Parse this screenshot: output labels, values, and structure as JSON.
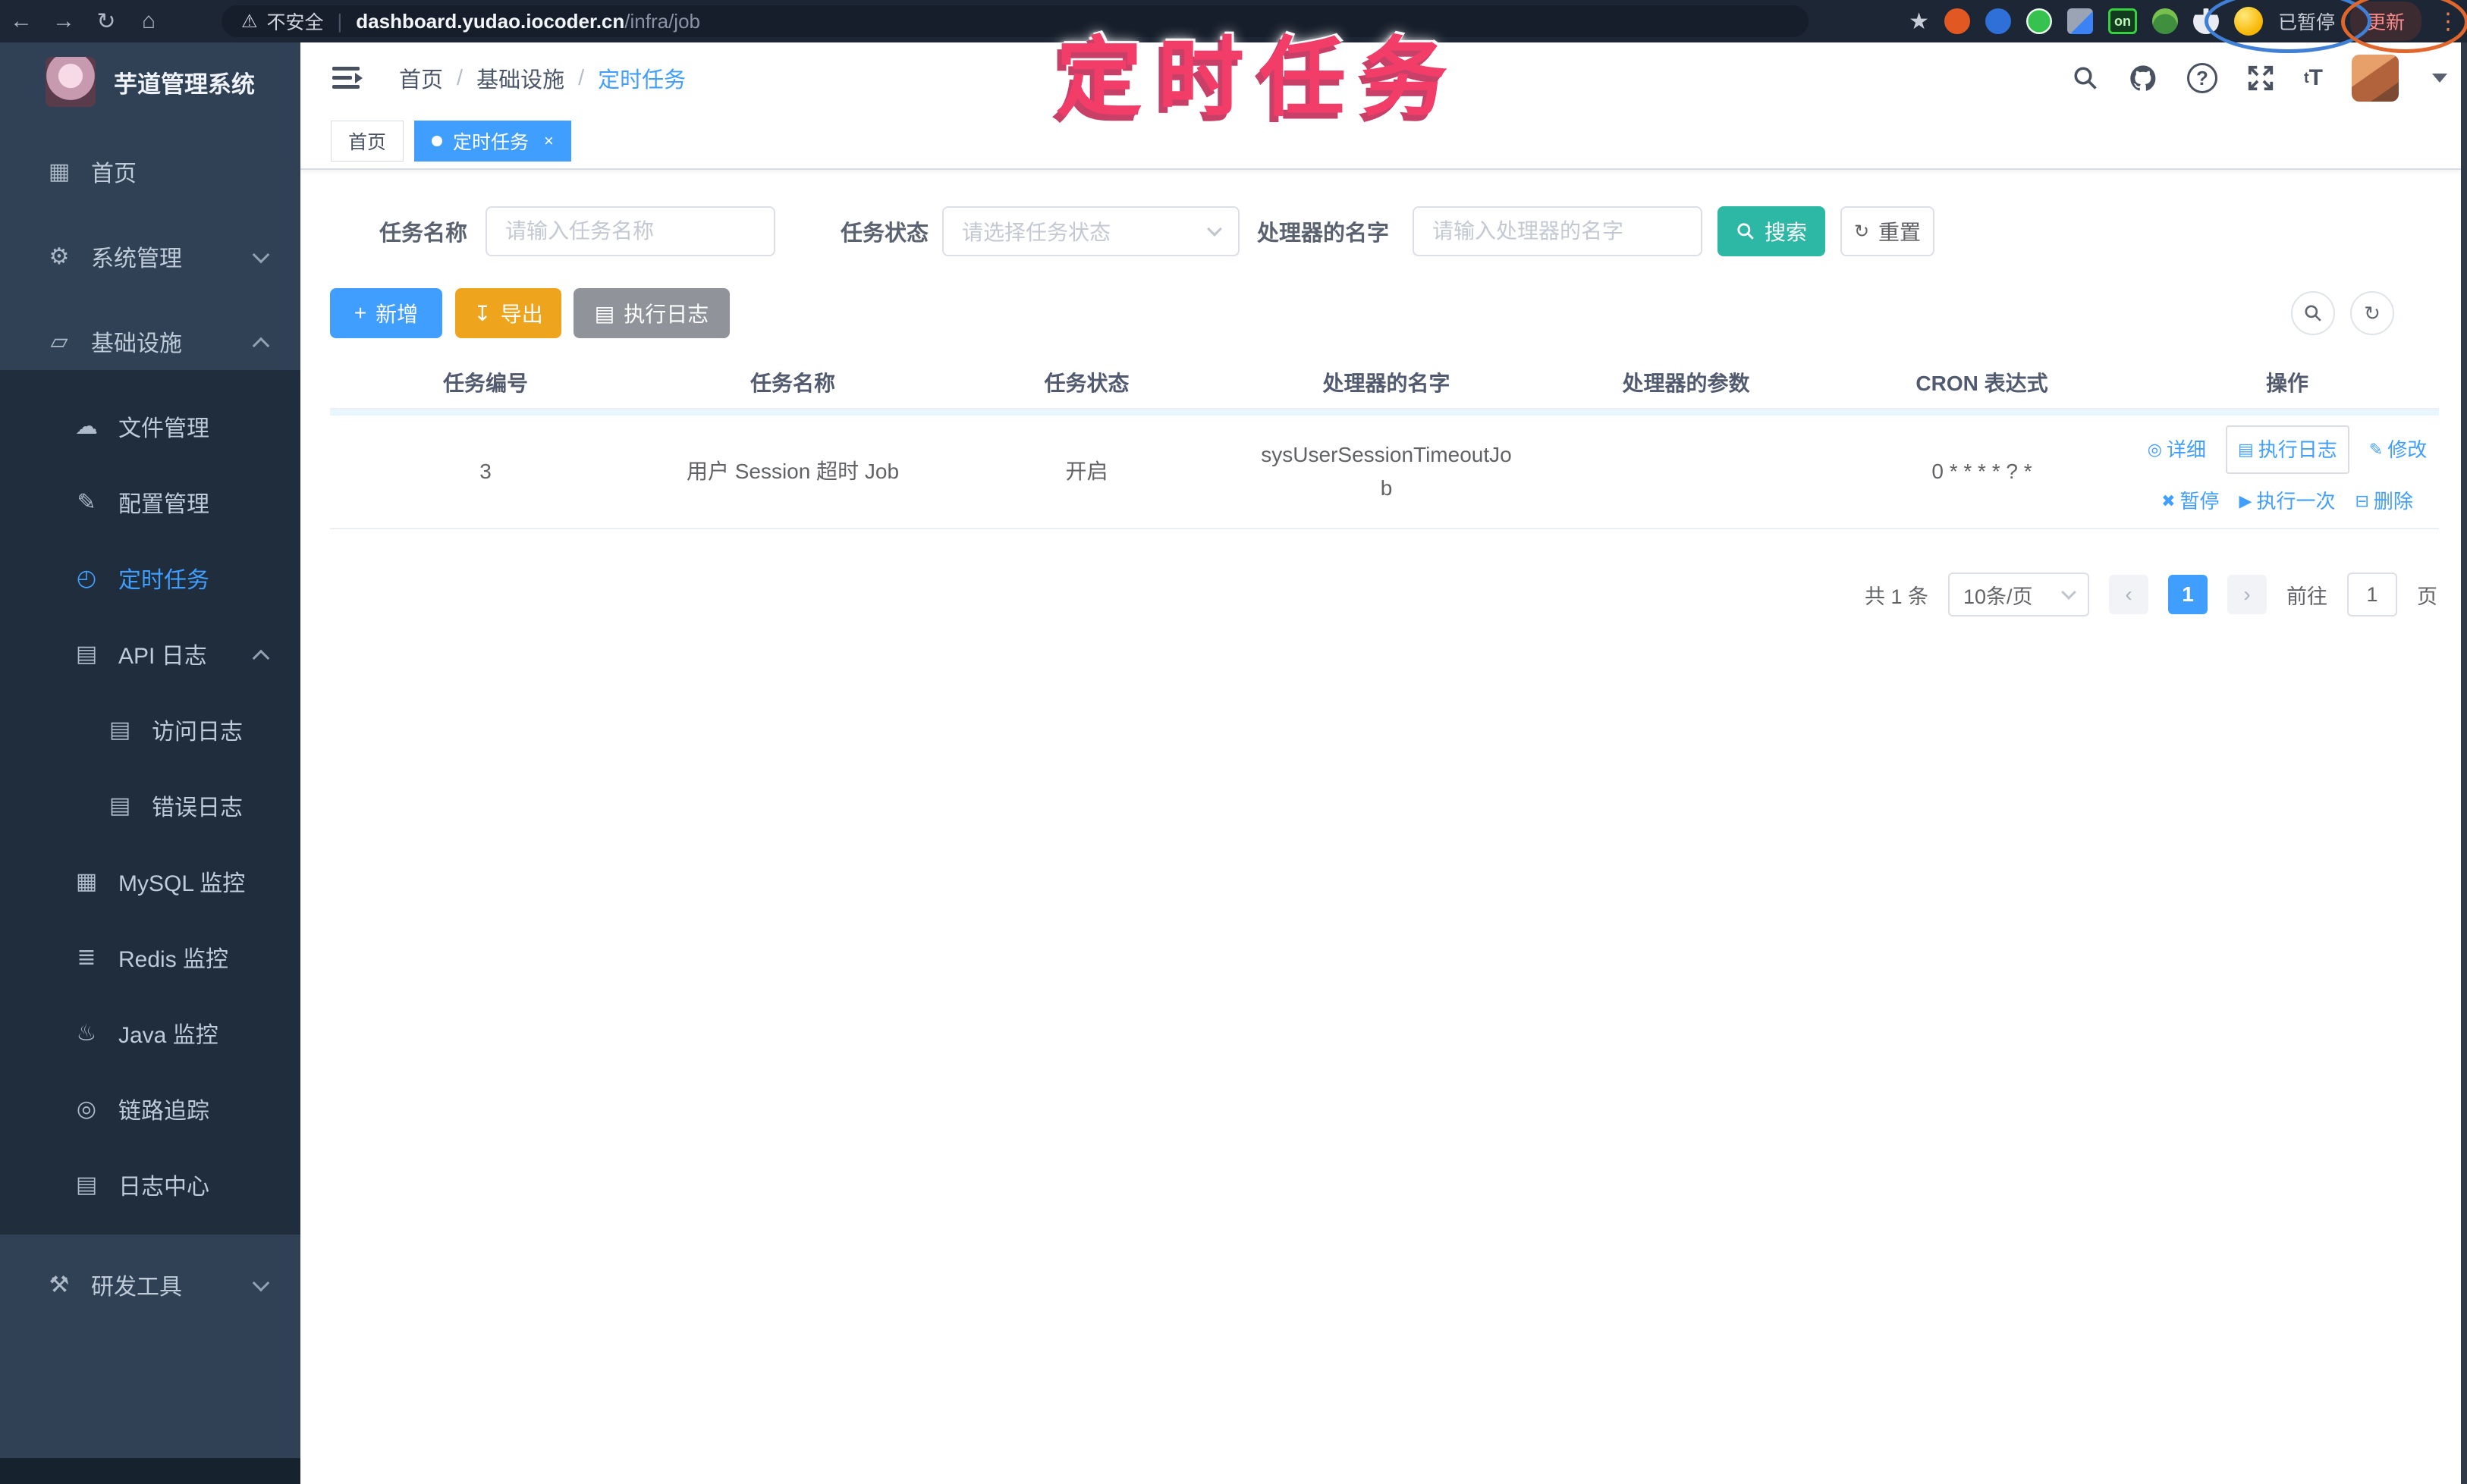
{
  "browser": {
    "security_label": "不安全",
    "url_host": "dashboard.yudao.iocoder.cn",
    "url_path": "/infra/job",
    "on_badge": "on",
    "paused_label": "已暂停",
    "update_label": "更新"
  },
  "annotation": {
    "watermark": "定时任务"
  },
  "colors": {
    "accent": "#409eff",
    "search_button": "#2db7a5",
    "export_button": "#efa41d",
    "info_button": "#909399",
    "sidebar_bg": "#304156",
    "submenu_bg": "#1f2d3d",
    "annotation_pink": "#f23d68"
  },
  "sidebar": {
    "app_title": "芋道管理系统",
    "items": [
      {
        "label": "首页",
        "icon": "dashboard-icon"
      },
      {
        "label": "系统管理",
        "icon": "gear-icon"
      },
      {
        "label": "基础设施",
        "icon": "infra-icon"
      },
      {
        "label": "文件管理",
        "icon": "cloud-upload-icon"
      },
      {
        "label": "配置管理",
        "icon": "config-icon"
      },
      {
        "label": "定时任务",
        "icon": "timer-icon"
      },
      {
        "label": "API 日志",
        "icon": "api-log-icon"
      },
      {
        "label": "访问日志",
        "icon": "access-log-icon"
      },
      {
        "label": "错误日志",
        "icon": "error-log-icon"
      },
      {
        "label": "MySQL 监控",
        "icon": "mysql-icon"
      },
      {
        "label": "Redis 监控",
        "icon": "redis-icon"
      },
      {
        "label": "Java 监控",
        "icon": "java-icon"
      },
      {
        "label": "链路追踪",
        "icon": "trace-icon"
      },
      {
        "label": "日志中心",
        "icon": "log-center-icon"
      },
      {
        "label": "研发工具",
        "icon": "devtools-icon"
      }
    ]
  },
  "header": {
    "breadcrumb": {
      "home": "首页",
      "section": "基础设施",
      "current": "定时任务"
    }
  },
  "tabs": {
    "home": "首页",
    "current": "定时任务"
  },
  "filters": {
    "job_name_label": "任务名称",
    "job_name_placeholder": "请输入任务名称",
    "job_status_label": "任务状态",
    "job_status_placeholder": "请选择任务状态",
    "handler_label": "处理器的名字",
    "handler_placeholder": "请输入处理器的名字",
    "search_label": "搜索",
    "reset_label": "重置"
  },
  "toolbar": {
    "add_label": "新增",
    "export_label": "导出",
    "exec_log_label": "执行日志"
  },
  "table": {
    "headers": [
      "任务编号",
      "任务名称",
      "任务状态",
      "处理器的名字",
      "处理器的参数",
      "CRON 表达式",
      "操作"
    ],
    "row": {
      "id": "3",
      "name": "用户 Session 超时 Job",
      "status": "开启",
      "handler": "sysUserSessionTimeoutJob",
      "param": "",
      "cron": "0 * * * * ? *"
    },
    "actions": {
      "detail": "详细",
      "exec_log": "执行日志",
      "edit": "修改",
      "pause": "暂停",
      "run_once": "执行一次",
      "delete": "删除"
    }
  },
  "pagination": {
    "total": "共 1 条",
    "page_size": "10条/页",
    "page": "1",
    "goto_label": "前往",
    "goto_value": "1",
    "page_unit": "页"
  }
}
